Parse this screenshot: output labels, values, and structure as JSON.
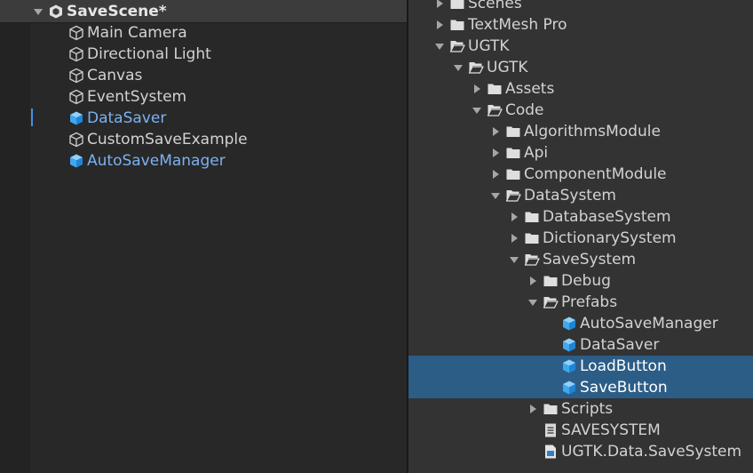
{
  "hierarchy": {
    "scene_name": "SaveScene*",
    "items": [
      {
        "label": "Main Camera",
        "type": "object"
      },
      {
        "label": "Directional Light",
        "type": "object"
      },
      {
        "label": "Canvas",
        "type": "object"
      },
      {
        "label": "EventSystem",
        "type": "object"
      },
      {
        "label": "DataSaver",
        "type": "prefab"
      },
      {
        "label": "CustomSaveExample",
        "type": "object"
      },
      {
        "label": "AutoSaveManager",
        "type": "prefab"
      }
    ]
  },
  "project": {
    "items": [
      {
        "label": "Scenes",
        "type": "folder",
        "arrow": "right"
      },
      {
        "label": "TextMesh Pro",
        "type": "folder",
        "arrow": "right"
      },
      {
        "label": "UGTK",
        "type": "folder-open",
        "arrow": "down"
      },
      {
        "label": "UGTK",
        "type": "folder-open",
        "arrow": "down"
      },
      {
        "label": "Assets",
        "type": "folder",
        "arrow": "right"
      },
      {
        "label": "Code",
        "type": "folder-open",
        "arrow": "down"
      },
      {
        "label": "AlgorithmsModule",
        "type": "folder",
        "arrow": "right"
      },
      {
        "label": "Api",
        "type": "folder",
        "arrow": "right"
      },
      {
        "label": "ComponentModule",
        "type": "folder",
        "arrow": "right"
      },
      {
        "label": "DataSystem",
        "type": "folder-open",
        "arrow": "down"
      },
      {
        "label": "DatabaseSystem",
        "type": "folder",
        "arrow": "right"
      },
      {
        "label": "DictionarySystem",
        "type": "folder",
        "arrow": "right"
      },
      {
        "label": "SaveSystem",
        "type": "folder-open",
        "arrow": "down"
      },
      {
        "label": "Debug",
        "type": "folder",
        "arrow": "right"
      },
      {
        "label": "Prefabs",
        "type": "folder-open",
        "arrow": "down"
      },
      {
        "label": "AutoSaveManager",
        "type": "prefab",
        "arrow": "none"
      },
      {
        "label": "DataSaver",
        "type": "prefab",
        "arrow": "none"
      },
      {
        "label": "LoadButton",
        "type": "prefab",
        "arrow": "none",
        "selected": true
      },
      {
        "label": "SaveButton",
        "type": "prefab",
        "arrow": "none",
        "selected": true
      },
      {
        "label": "Scripts",
        "type": "folder",
        "arrow": "right"
      },
      {
        "label": "SAVESYSTEM",
        "type": "text-asset",
        "arrow": "none"
      },
      {
        "label": "UGTK.Data.SaveSystem",
        "type": "assembly",
        "arrow": "none"
      }
    ]
  }
}
